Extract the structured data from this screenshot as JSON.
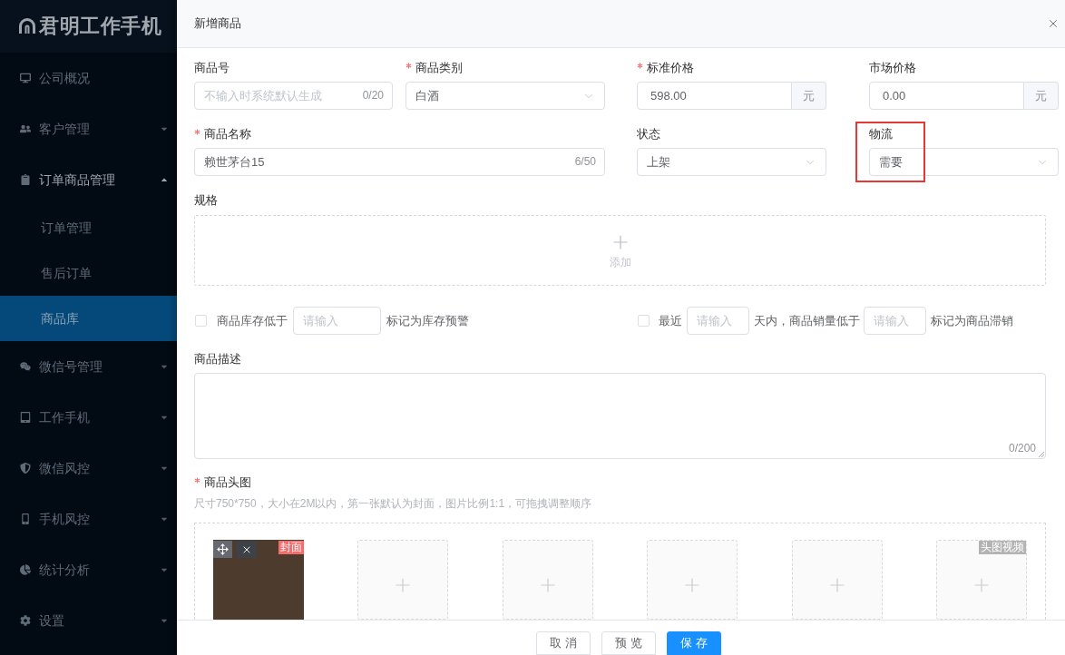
{
  "sidebar": {
    "logo": "君明工作手机",
    "menu": [
      {
        "label": "公司概况",
        "kind": "link",
        "selected": false
      },
      {
        "label": "客户管理",
        "kind": "group",
        "expanded": false,
        "selected": false
      },
      {
        "label": "订单商品管理",
        "kind": "group",
        "expanded": true,
        "selected": false,
        "children": [
          {
            "label": "订单管理",
            "selected": false
          },
          {
            "label": "售后订单",
            "selected": false
          },
          {
            "label": "商品库",
            "selected": true
          }
        ]
      },
      {
        "label": "微信号管理",
        "kind": "group",
        "expanded": false,
        "selected": false
      },
      {
        "label": "工作手机",
        "kind": "group",
        "expanded": false,
        "selected": false
      },
      {
        "label": "微信风控",
        "kind": "group",
        "expanded": false,
        "selected": false
      },
      {
        "label": "手机风控",
        "kind": "group",
        "expanded": false,
        "selected": false
      },
      {
        "label": "统计分析",
        "kind": "group",
        "expanded": false,
        "selected": false
      },
      {
        "label": "设置",
        "kind": "group",
        "expanded": false,
        "selected": false
      }
    ]
  },
  "panel": {
    "title": "新增商品",
    "product_number": {
      "label": "商品号",
      "required": false,
      "placeholder": "不输入时系统默认生成",
      "counter": "0/20"
    },
    "category": {
      "label": "商品类别",
      "required": true,
      "value": "白酒"
    },
    "standard_price": {
      "label": "标准价格",
      "required": true,
      "value": "598.00",
      "unit": "元"
    },
    "market_price": {
      "label": "市场价格",
      "required": false,
      "value": "0.00",
      "unit": "元"
    },
    "product_name": {
      "label": "商品名称",
      "required": true,
      "value": "赖世茅台15",
      "counter": "6/50"
    },
    "status": {
      "label": "状态",
      "required": false,
      "value": "上架"
    },
    "logistics": {
      "label": "物流",
      "required": false,
      "value": "需要",
      "highlighted": true
    },
    "specs": {
      "label": "规格",
      "add_label": "添加"
    },
    "stock_warning": {
      "checked": false,
      "text_before": "商品库存低于",
      "placeholder": "请输入",
      "text_after": "标记为库存预警"
    },
    "slow_sales": {
      "checked": false,
      "text_1": "最近",
      "placeholder_1": "请输入",
      "text_2": "天内，商品销量低于",
      "placeholder_2": "请输入",
      "text_3": "标记为商品滞销"
    },
    "description": {
      "label": "商品描述",
      "counter": "0/200"
    },
    "cover_images": {
      "label": "商品头图",
      "required": true,
      "hint": "尺寸750*750，大小在2M以内，第一张默认为封面，图片比例1:1，可拖拽调整顺序",
      "tiles": [
        {
          "kind": "image",
          "badge": "封面"
        },
        {
          "kind": "empty"
        },
        {
          "kind": "empty"
        },
        {
          "kind": "empty"
        },
        {
          "kind": "empty"
        },
        {
          "kind": "video",
          "badge": "头图视频"
        }
      ]
    }
  },
  "footer": {
    "buttons": [
      {
        "label": "取消",
        "kind": "default"
      },
      {
        "label": "预览",
        "kind": "default"
      },
      {
        "label": "保存",
        "kind": "primary"
      }
    ]
  }
}
